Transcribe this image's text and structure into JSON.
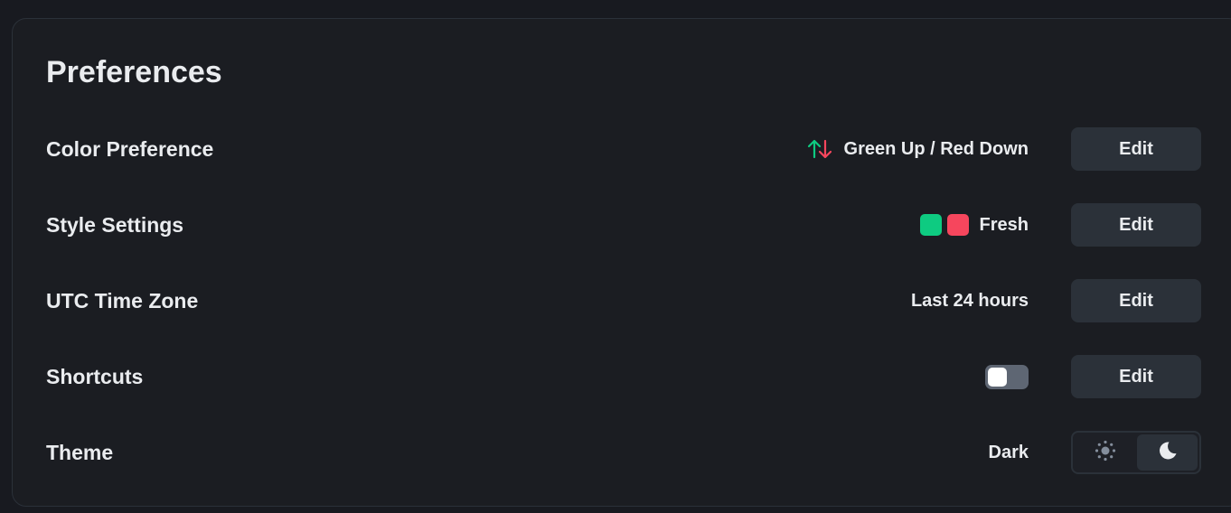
{
  "page": {
    "title": "Preferences"
  },
  "rows": {
    "color_preference": {
      "label": "Color Preference",
      "value": "Green Up / Red Down",
      "icon": "up-down-arrows-icon",
      "button": "Edit"
    },
    "style_settings": {
      "label": "Style Settings",
      "value": "Fresh",
      "swatch_colors": [
        "#0ecb81",
        "#f6465d"
      ],
      "button": "Edit"
    },
    "utc_time_zone": {
      "label": "UTC Time Zone",
      "value": "Last 24 hours",
      "button": "Edit"
    },
    "shortcuts": {
      "label": "Shortcuts",
      "toggle_on": false,
      "button": "Edit"
    },
    "theme": {
      "label": "Theme",
      "value": "Dark",
      "options": [
        {
          "icon": "sun-icon",
          "active": false
        },
        {
          "icon": "moon-icon",
          "active": true
        }
      ]
    }
  },
  "colors": {
    "up": "#0ecb81",
    "down": "#f6465d",
    "background": "#181a20",
    "card": "#1b1d22",
    "button": "#2b3139",
    "text": "#eaecef"
  }
}
